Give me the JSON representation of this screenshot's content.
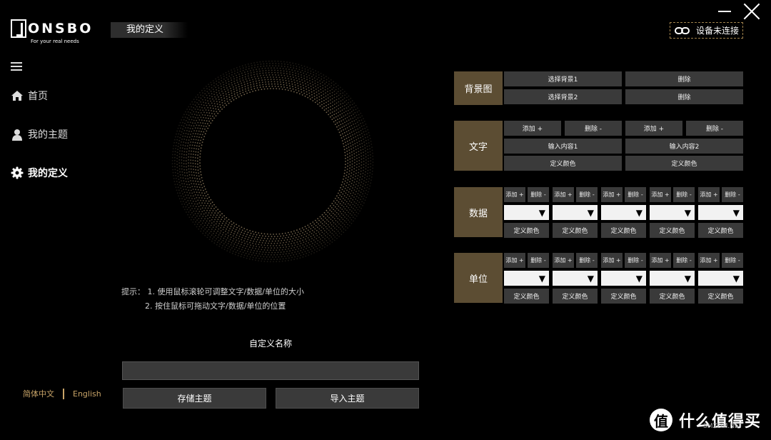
{
  "brand": {
    "logo_text": "ONSBO",
    "tagline": "For your real needs"
  },
  "header": {
    "page_title": "我的定义",
    "device_status": "设备未连接"
  },
  "sidebar": {
    "items": [
      {
        "label": "首页",
        "icon": "home-icon"
      },
      {
        "label": "我的主题",
        "icon": "user-icon"
      },
      {
        "label": "我的定义",
        "icon": "gear-icon",
        "active": true
      }
    ],
    "lang_zh": "简体中文",
    "lang_en": "English"
  },
  "tips": {
    "line1": "提示：  1. 使用鼠标滚轮可调整文字/数据/单位的大小",
    "line2": "2. 按住鼠标可拖动文字/数据/单位的位置"
  },
  "custom_name": {
    "label": "自定义名称",
    "value": "",
    "placeholder": ""
  },
  "actions": {
    "save": "存储主题",
    "import": "导入主题"
  },
  "panels": {
    "background": {
      "label": "背景图",
      "select1": "选择背景1",
      "delete1": "删除",
      "select2": "选择背景2",
      "delete2": "删除"
    },
    "text": {
      "label": "文字",
      "add1": "添加 +",
      "del1": "删除 -",
      "add2": "添加 +",
      "del2": "删除 -",
      "input1": "输入内容1",
      "input2": "输入内容2",
      "color1": "定义颜色",
      "color2": "定义颜色"
    },
    "data": {
      "label": "数据",
      "add": "添加 +",
      "del": "删除 -",
      "color": "定义颜色",
      "select_arrow": "▼"
    },
    "unit": {
      "label": "单位",
      "add": "添加 +",
      "del": "删除 -",
      "color": "定义颜色",
      "select_arrow": "▼"
    }
  },
  "colors": {
    "accent": "#5c4d33",
    "button_bg": "#3a3a3a",
    "lang": "#c8a468",
    "ring": "#7a6a50"
  },
  "watermark": {
    "logo": "值",
    "text": "什么值得买",
    "sub": "SMZDM.NET"
  }
}
